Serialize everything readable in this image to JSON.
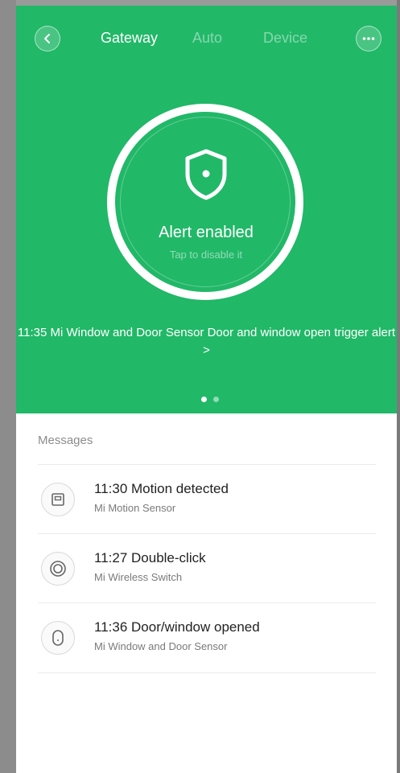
{
  "nav": {
    "tabs": [
      {
        "label": "Gateway",
        "active": true
      },
      {
        "label": "Auto",
        "active": false
      },
      {
        "label": "Device",
        "active": false
      }
    ]
  },
  "alarm": {
    "status": "Alert enabled",
    "hint": "Tap to disable it"
  },
  "last_event": {
    "text": "11:35  Mi Window and Door Sensor Door and window open trigger alert  >"
  },
  "pager": {
    "count": 2,
    "current": 1
  },
  "messages": {
    "header": "Messages",
    "items": [
      {
        "time": "11:30",
        "event": "Motion detected",
        "title": "11:30  Motion detected",
        "device": "Mi Motion Sensor",
        "icon": "motion-sensor-icon"
      },
      {
        "time": "11:27",
        "event": "Double-click",
        "title": "11:27  Double-click",
        "device": "Mi Wireless Switch",
        "icon": "wireless-switch-icon"
      },
      {
        "time": "11:36",
        "event": "Door/window opened",
        "title": "11:36  Door/window opened",
        "device": "Mi Window and Door Sensor",
        "icon": "door-sensor-icon"
      }
    ]
  },
  "colors": {
    "accent": "#21b868"
  }
}
